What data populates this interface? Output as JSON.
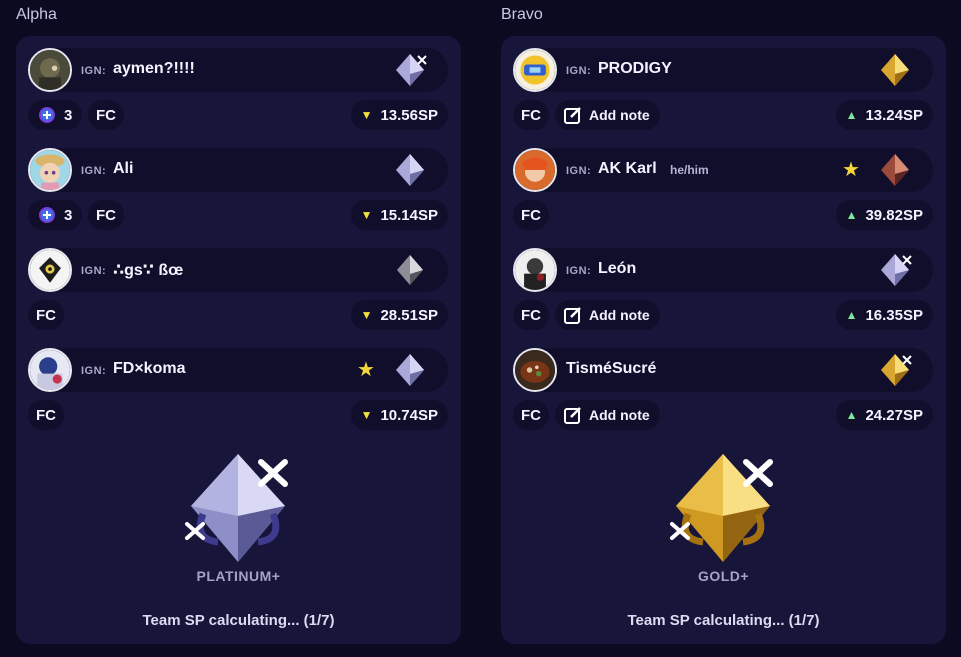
{
  "ign_prefix": "IGN:",
  "teams": [
    {
      "label": "Alpha",
      "rank": "PLATINUM+",
      "team_sp": "Team SP calculating... (1/7)",
      "emblem_color": "#b8b8e0",
      "players": [
        {
          "ign_shown": true,
          "name": "aymen?!!!!",
          "pronouns": "",
          "star": false,
          "rank_icon": "platinum-rank-icon",
          "badge": "3",
          "fc": "FC",
          "note": "",
          "sp_direction": "down",
          "sp": "13.56SP"
        },
        {
          "ign_shown": true,
          "name": "Ali",
          "pronouns": "",
          "star": false,
          "rank_icon": "platinum-rank-icon",
          "badge": "3",
          "fc": "FC",
          "note": "",
          "sp_direction": "down",
          "sp": "15.14SP"
        },
        {
          "ign_shown": true,
          "name": "∴gs∵ ßœ",
          "pronouns": "",
          "star": false,
          "rank_icon": "silver-rank-icon",
          "badge": "",
          "fc": "FC",
          "note": "",
          "sp_direction": "down",
          "sp": "28.51SP"
        },
        {
          "ign_shown": true,
          "name": "FD×koma",
          "pronouns": "",
          "star": true,
          "rank_icon": "platinum-rank-icon",
          "badge": "",
          "fc": "FC",
          "note": "",
          "sp_direction": "down",
          "sp": "10.74SP"
        }
      ]
    },
    {
      "label": "Bravo",
      "rank": "GOLD+",
      "team_sp": "Team SP calculating... (1/7)",
      "emblem_color": "#e2b33a",
      "players": [
        {
          "ign_shown": true,
          "name": "PRODIGY",
          "pronouns": "",
          "star": false,
          "rank_icon": "gold-rank-icon",
          "badge": "",
          "fc": "FC",
          "note": "Add note",
          "sp_direction": "up",
          "sp": "13.24SP"
        },
        {
          "ign_shown": true,
          "name": "AK Karl",
          "pronouns": "he/him",
          "star": true,
          "rank_icon": "bronze-rank-icon",
          "badge": "",
          "fc": "FC",
          "note": "",
          "sp_direction": "up",
          "sp": "39.82SP"
        },
        {
          "ign_shown": true,
          "name": "León",
          "pronouns": "",
          "star": false,
          "rank_icon": "platinum-rank-icon",
          "badge": "",
          "fc": "FC",
          "note": "Add note",
          "sp_direction": "up",
          "sp": "16.35SP"
        },
        {
          "ign_shown": false,
          "name": "TisméSucré",
          "pronouns": "",
          "star": false,
          "rank_icon": "gold-rank-icon",
          "badge": "",
          "fc": "FC",
          "note": "Add note",
          "sp_direction": "up",
          "sp": "24.27SP"
        }
      ]
    }
  ]
}
